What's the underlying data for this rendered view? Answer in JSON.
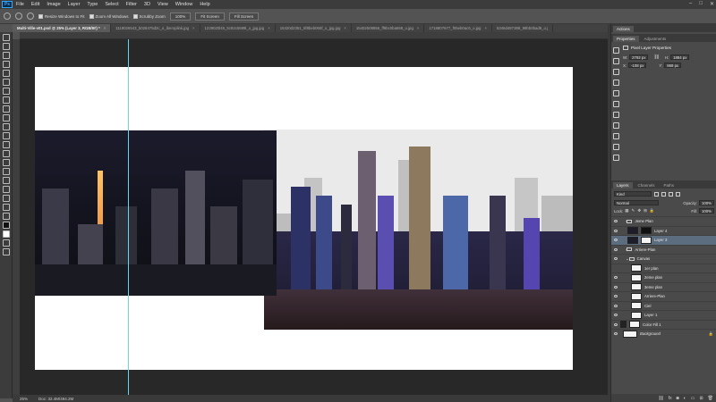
{
  "app": {
    "logo": "Ps",
    "menu": [
      "File",
      "Edit",
      "Image",
      "Layer",
      "Type",
      "Select",
      "Filter",
      "3D",
      "View",
      "Window",
      "Help"
    ],
    "window_controls": [
      "–",
      "□",
      "✕"
    ]
  },
  "options": {
    "resize_windows": "Resize Windows to Fit",
    "zoom_all": "Zoom All Windows",
    "scrubby_zoom": "Scrubby Zoom",
    "zoom_value": "100%",
    "fit_screen": "Fit Screen",
    "fill_screen": "Fill Screen"
  },
  "tabs": [
    {
      "label": "Multi-Ville-v01.psd @ 25% (Layer 3, RGB/8#) *",
      "active": true
    },
    {
      "label": "1119026543_b028475d2c_o_iberoplink.jpg",
      "active": false
    },
    {
      "label": "1229020l45_5c92c5699l_o_jpg.jpg",
      "active": false
    },
    {
      "label": "15420d2351_5f8beb065f_o_jpg.jpg",
      "active": false
    },
    {
      "label": "15402508856_ff9bc0ba658_o.jpg",
      "active": false
    },
    {
      "label": "1718807677_f05eb0ac6_o.jpg",
      "active": false
    },
    {
      "label": "5346d487388_98bb0bad9_o.j",
      "active": false
    }
  ],
  "status": {
    "zoom": "25%",
    "doc": "Doc: 32.4M/494.2M"
  },
  "panels": {
    "top_tabs": [
      "Actions"
    ],
    "properties_tabs": [
      "Properties",
      "Adjustments"
    ],
    "properties_title": "Pixel Layer Properties",
    "w_label": "W:",
    "w_value": "2792 px",
    "h_label": "H:",
    "h_value": "1884 px",
    "x_label": "X:",
    "x_value": "-108 px",
    "y_label": "Y:",
    "y_value": "869 px",
    "layers_tabs": [
      "Layers",
      "Channels",
      "Paths"
    ],
    "kind": "Kind",
    "blend_mode": "Normal",
    "opacity_label": "Opacity:",
    "opacity_value": "100%",
    "lock_label": "Lock:",
    "fill_label": "Fill:",
    "fill_value": "100%",
    "layers": [
      {
        "name": "Jeme Plan",
        "type": "folder",
        "visible": true,
        "selected": false
      },
      {
        "name": "Layer 4",
        "type": "mask",
        "visible": true,
        "selected": false
      },
      {
        "name": "Layer 3",
        "type": "mask",
        "visible": true,
        "selected": true
      },
      {
        "name": "Arriere-Plan",
        "type": "folder",
        "visible": true,
        "selected": false
      },
      {
        "name": "Canvas",
        "type": "folder",
        "visible": true,
        "selected": false
      },
      {
        "name": "1er plan",
        "type": "pixel",
        "visible": false,
        "selected": false
      },
      {
        "name": "2eme plan",
        "type": "pixel",
        "visible": true,
        "selected": false
      },
      {
        "name": "3eme plan",
        "type": "pixel",
        "visible": true,
        "selected": false
      },
      {
        "name": "Arriere-Plan",
        "type": "pixel",
        "visible": true,
        "selected": false
      },
      {
        "name": "Ciel",
        "type": "pixel",
        "visible": true,
        "selected": false
      },
      {
        "name": "Layer 1",
        "type": "pixel",
        "visible": true,
        "selected": false
      },
      {
        "name": "Color Fill 1",
        "type": "fill",
        "visible": true,
        "selected": false
      },
      {
        "name": "Background",
        "type": "background",
        "visible": true,
        "selected": false
      }
    ]
  }
}
